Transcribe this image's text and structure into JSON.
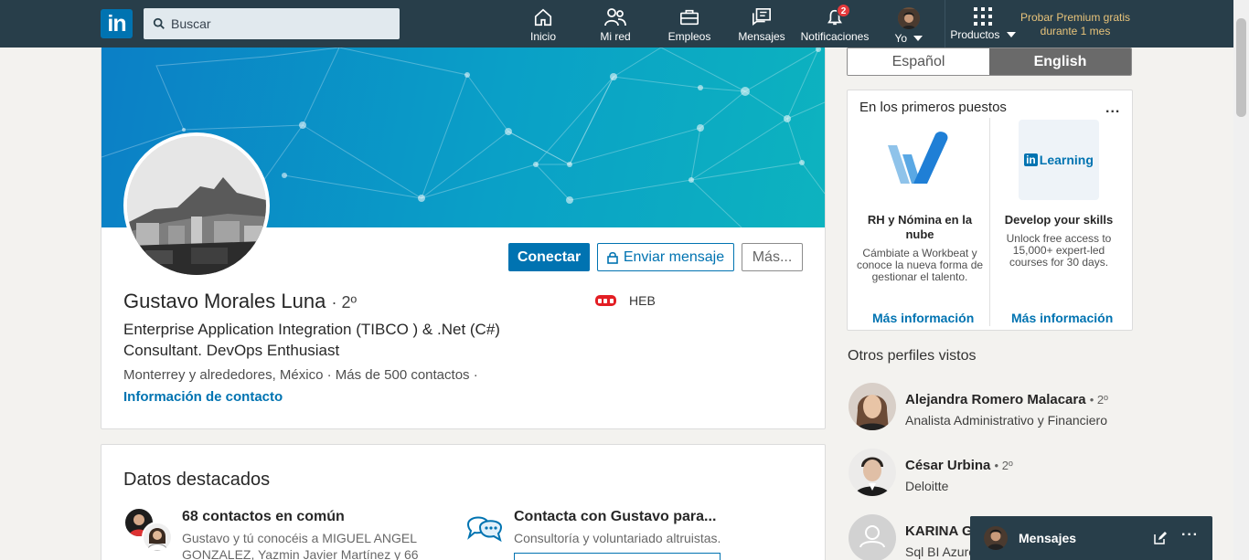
{
  "nav": {
    "logo_text": "in",
    "search_placeholder": "Buscar",
    "items": [
      {
        "label": "Inicio",
        "icon": "home-icon"
      },
      {
        "label": "Mi red",
        "icon": "network-icon"
      },
      {
        "label": "Empleos",
        "icon": "briefcase-icon"
      },
      {
        "label": "Mensajes",
        "icon": "messaging-icon"
      },
      {
        "label": "Notificaciones",
        "icon": "bell-icon",
        "badge": "2"
      },
      {
        "label": "Yo",
        "icon": "avatar"
      },
      {
        "label": "Productos",
        "icon": "grid-icon"
      }
    ],
    "premium": "Probar Premium gratis durante 1 mes"
  },
  "profile": {
    "connect_label": "Conectar",
    "message_label": "Enviar mensaje",
    "more_label": "Más...",
    "name": "Gustavo Morales Luna",
    "degree": "2º",
    "headline": "Enterprise Application Integration (TIBCO ) & .Net (C#) Consultant. DevOps Enthusiast",
    "location": "Monterrey y alrededores, México",
    "connections": "Más de 500 contactos",
    "contact_info": "Información de contacto",
    "company": "HEB"
  },
  "highlights": {
    "title": "Datos destacados",
    "mutual_title": "68 contactos en común",
    "mutual_sub": "Gustavo y tú conocéis a MIGUEL ANGEL GONZALEZ, Yazmin Javier Martínez y 66",
    "contact_title": "Contacta con Gustavo para...",
    "contact_sub": "Consultoría y voluntariado altruistas."
  },
  "lang": {
    "spanish": "Español",
    "english": "English"
  },
  "ad": {
    "title": "En los primeros puestos",
    "menu": "...",
    "items": [
      {
        "title": "RH y Nómina en la nube",
        "desc": "Cámbiate a Workbeat y conoce la nueva forma de gestionar el talento.",
        "link": "Más información"
      },
      {
        "logo_in": "in",
        "logo_text": "Learning",
        "title": "Develop your skills",
        "desc": "Unlock free access to 15,000+ expert-led courses for 30 days.",
        "link": "Más información"
      }
    ]
  },
  "others": {
    "title": "Otros perfiles vistos",
    "people": [
      {
        "name": "Alejandra Romero Malacara",
        "degree": "• 2º",
        "job": "Analista Administrativo y Financiero"
      },
      {
        "name": "César Urbina",
        "degree": "• 2º",
        "job": "Deloitte"
      },
      {
        "name": "KARINA G",
        "degree": "",
        "job": "Sql BI Azure"
      }
    ]
  },
  "messaging": {
    "label": "Mensajes",
    "compose_icon": "compose-icon",
    "menu": "···"
  },
  "colors": {
    "nav": "#283e4a",
    "brand": "#0073b1",
    "premium": "#e8c37a",
    "badge": "#e4393c"
  }
}
